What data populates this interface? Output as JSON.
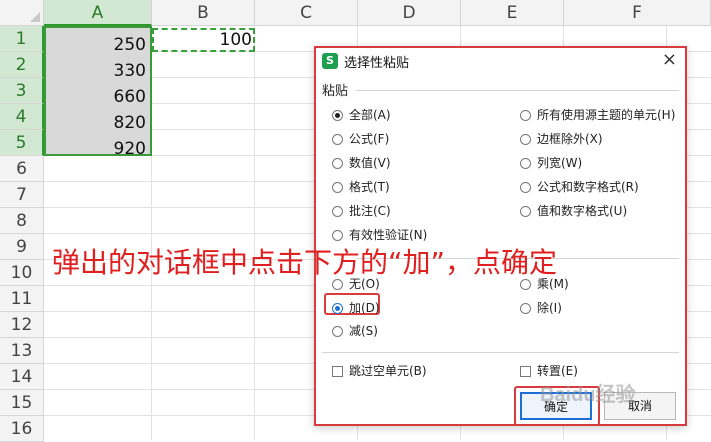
{
  "sheet": {
    "columns": [
      "A",
      "B",
      "C",
      "D",
      "E",
      "F"
    ],
    "rows": [
      "1",
      "2",
      "3",
      "4",
      "5",
      "6",
      "7",
      "8",
      "9",
      "10",
      "11",
      "12",
      "13",
      "14",
      "15",
      "16"
    ],
    "column_a_values": [
      "250",
      "330",
      "660",
      "820",
      "920"
    ],
    "b1_value": "100"
  },
  "dialog": {
    "title": "选择性粘贴",
    "app_icon": "S",
    "close_label": "×",
    "paste_section": "粘贴",
    "paste_options_left": [
      "全部(A)",
      "公式(F)",
      "数值(V)",
      "格式(T)",
      "批注(C)",
      "有效性验证(N)"
    ],
    "paste_options_right": [
      "所有使用源主题的单元(H)",
      "边框除外(X)",
      "列宽(W)",
      "公式和数字格式(R)",
      "值和数字格式(U)"
    ],
    "operation_options": [
      "无(O)",
      "乘(M)",
      "加(D)",
      "除(I)",
      "减(S)"
    ],
    "skip_blanks": "跳过空单元(B)",
    "transpose": "转置(E)",
    "ok_label": "确定",
    "cancel_label": "取消"
  },
  "annotation": {
    "text": "弹出的对话框中点击下方的“加”，点确定",
    "color": "#e02020"
  },
  "watermark": {
    "text": "Baidu经验"
  }
}
